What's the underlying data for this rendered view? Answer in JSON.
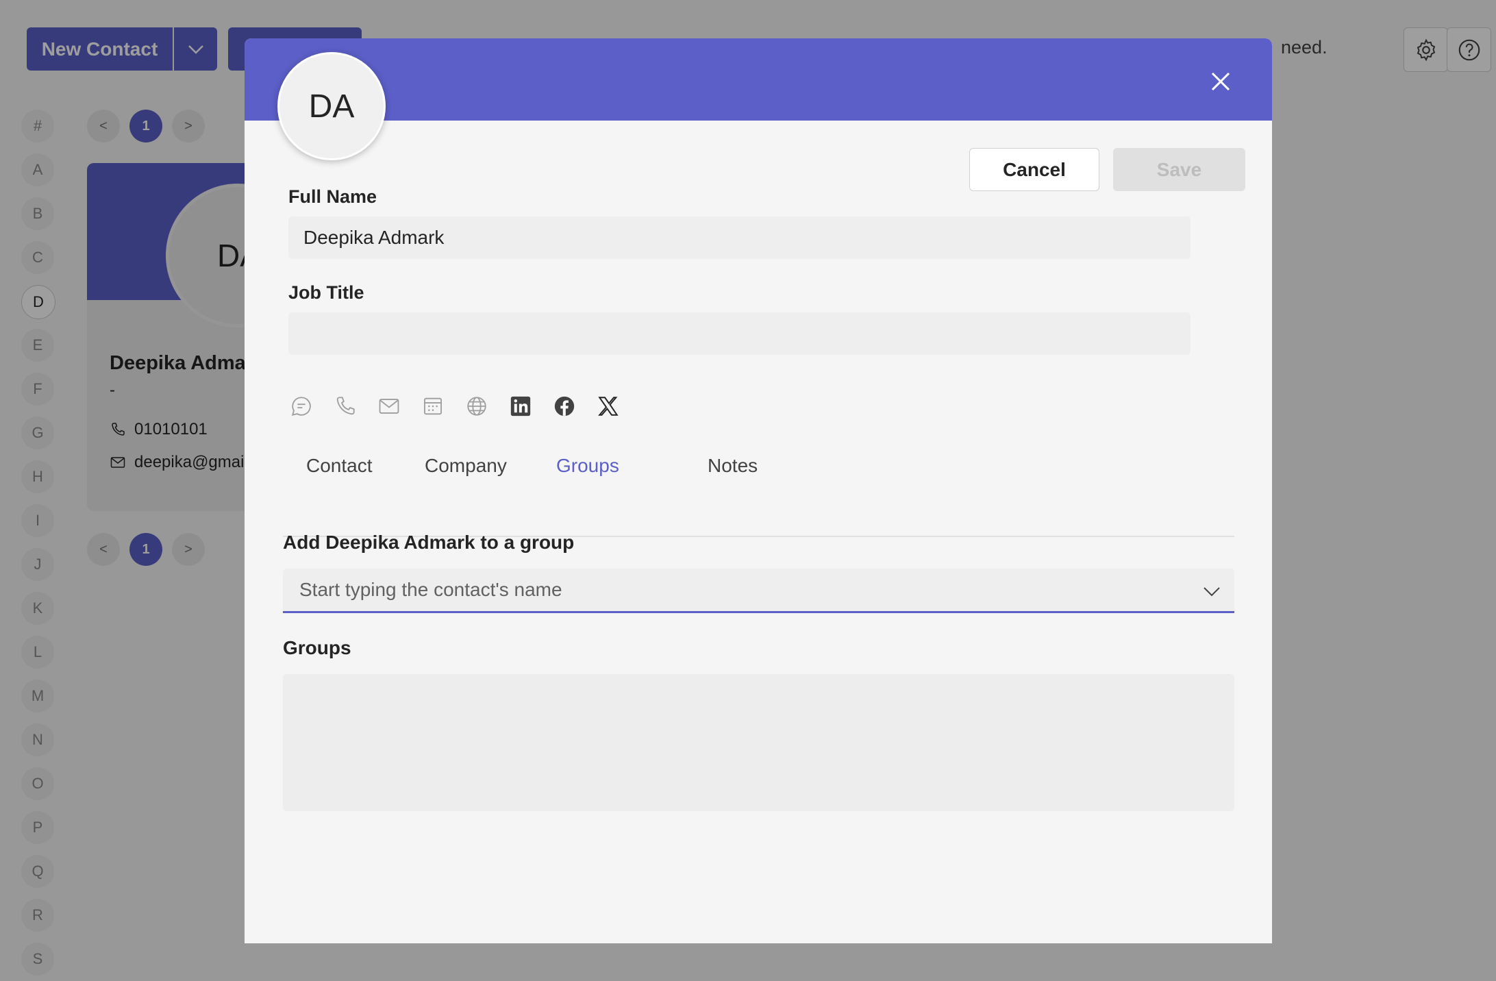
{
  "background": {
    "new_contact_label": "New Contact",
    "hint_fragment": "need.",
    "alphabet": [
      "#",
      "A",
      "B",
      "C",
      "D",
      "E",
      "F",
      "G",
      "H",
      "I",
      "J",
      "K",
      "L",
      "M",
      "N",
      "O",
      "P",
      "Q",
      "R",
      "S"
    ],
    "active_letter": "D",
    "pager": {
      "prev": "<",
      "page": "1",
      "next": ">"
    },
    "card": {
      "initials": "DA",
      "name": "Deepika Adma",
      "job": "-",
      "phone": "01010101",
      "email": "deepika@gmail"
    }
  },
  "dialog": {
    "initials": "DA",
    "cancel_label": "Cancel",
    "save_label": "Save",
    "full_name_label": "Full Name",
    "full_name_value": "Deepika Admark",
    "job_title_label": "Job Title",
    "job_title_value": "",
    "quick_icons": [
      "chat-icon",
      "phone-icon",
      "mail-icon",
      "calendar-icon",
      "globe-icon",
      "linkedin-icon",
      "facebook-icon",
      "x-icon"
    ],
    "tabs": [
      "Contact",
      "Company",
      "Groups",
      "Notes"
    ],
    "selected_tab": "Groups",
    "add_group_label": "Add Deepika Admark to a group",
    "group_search_placeholder": "Start typing the contact's name",
    "groups_label": "Groups",
    "groups": []
  },
  "colors": {
    "accent": "#5b5fc7"
  }
}
